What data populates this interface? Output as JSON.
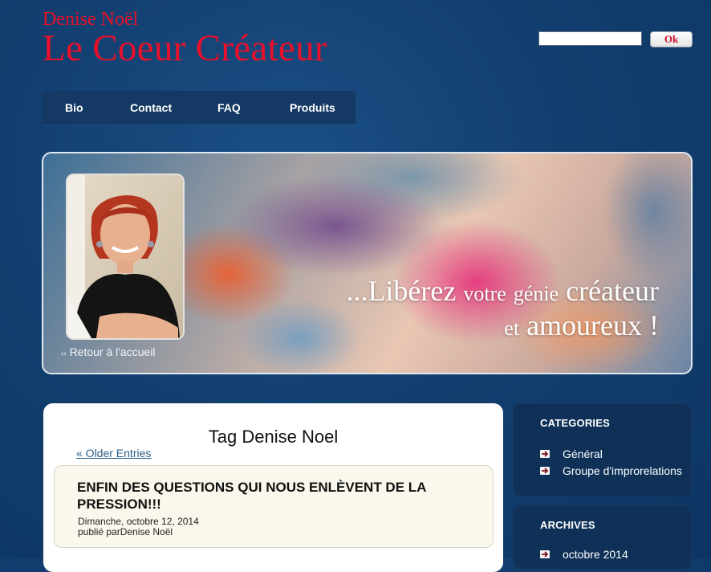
{
  "header": {
    "brand_name": "Denise Noël",
    "site_title": "Le Coeur Créateur"
  },
  "search": {
    "placeholder": "",
    "value": "",
    "button_label": "Ok"
  },
  "nav": {
    "items": [
      {
        "label": "Bio"
      },
      {
        "label": "Contact"
      },
      {
        "label": "FAQ"
      },
      {
        "label": "Produits"
      }
    ]
  },
  "banner": {
    "tagline_prefix": "...",
    "tagline_word1": "Libérez",
    "tagline_word2": "votre",
    "tagline_word3": "génie",
    "tagline_word4": "créateur",
    "tagline_word5": "et",
    "tagline_word6": "amoureux !",
    "back_link": "Retour à l'accueil",
    "back_arrow": "‹‹"
  },
  "content": {
    "page_title": "Tag Denise Noel",
    "older_entries": "« Older Entries",
    "post": {
      "title": "ENFIN DES QUESTIONS QUI NOUS ENLÈVENT DE LA PRESSION!!!",
      "date": "Dimanche, octobre 12, 2014",
      "author": "publié parDenise Noël"
    }
  },
  "sidebar": {
    "categories": {
      "heading": "CATEGORIES",
      "items": [
        {
          "label": "Général"
        },
        {
          "label": "Groupe d'improrelations"
        }
      ]
    },
    "archives": {
      "heading": "ARCHIVES",
      "items": [
        {
          "label": "octobre 2014"
        }
      ]
    }
  },
  "colors": {
    "brand_red": "#e8102a",
    "background_blue": "#123f70",
    "sidebar_box": "#0f3158",
    "link_blue": "#2b5f86"
  }
}
